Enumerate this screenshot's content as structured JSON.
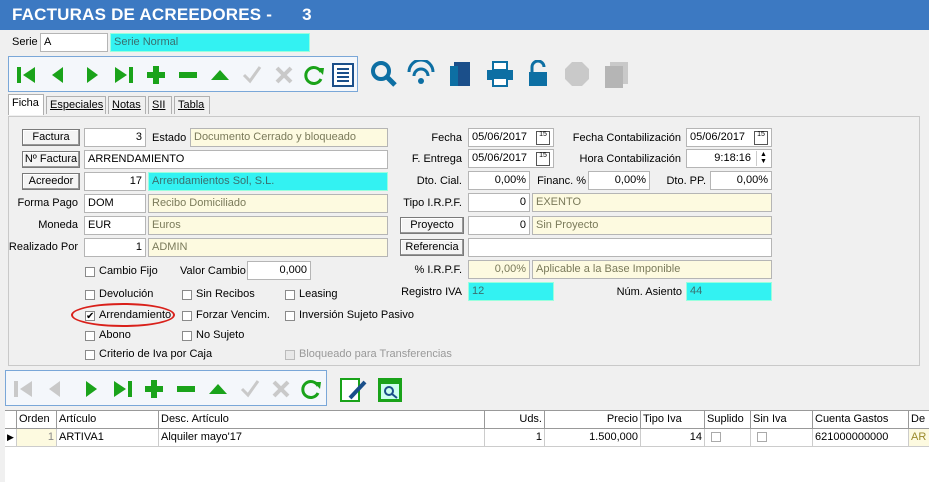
{
  "window": {
    "title": "FACTURAS DE ACREEDORES -",
    "number": "3"
  },
  "serie": {
    "label": "Serie",
    "code": "A",
    "name": "Serie Normal"
  },
  "toolbar_icons": [
    "first-icon",
    "prev-icon",
    "next-icon",
    "last-icon",
    "add-icon",
    "remove-icon",
    "up-icon",
    "check-icon",
    "cancel-icon",
    "refresh-icon",
    "list-icon",
    "search-icon",
    "wireless-icon",
    "door-icon",
    "print-icon",
    "unlock-icon",
    "circle-icon",
    "copy-icon"
  ],
  "tabs": [
    "Ficha",
    "Especiales",
    "Notas",
    "SII",
    "Tabla"
  ],
  "form": {
    "factura_label": "Factura",
    "factura": "3",
    "estado_label": "Estado",
    "estado": "Documento Cerrado y bloqueado",
    "nfactura_label": "Nº Factura",
    "nfactura": "ARRENDAMIENTO",
    "acreedor_label": "Acreedor",
    "acreedor_code": "17",
    "acreedor_name": "Arrendamientos Sol, S.L.",
    "formapago_label": "Forma Pago",
    "formapago_code": "DOM",
    "formapago_name": "Recibo Domiciliado",
    "moneda_label": "Moneda",
    "moneda_code": "EUR",
    "moneda_name": "Euros",
    "realizado_label": "Realizado Por",
    "realizado_code": "1",
    "realizado_name": "ADMIN",
    "fecha_label": "Fecha",
    "fecha": "05/06/2017",
    "fentrega_label": "F. Entrega",
    "fentrega": "05/06/2017",
    "fcontab_label": "Fecha Contabilización",
    "fcontab": "05/06/2017",
    "hcontab_label": "Hora Contabilización",
    "hcontab": "9:18:16",
    "dtocial_label": "Dto. Cial.",
    "dtocial": "0,00%",
    "financ_label": "Financ. %",
    "financ": "0,00%",
    "dtopp_label": "Dto. PP.",
    "dtopp": "0,00%",
    "irpf_label": "Tipo I.R.P.F.",
    "irpf_code": "0",
    "irpf_name": "EXENTO",
    "proyecto_label": "Proyecto",
    "proyecto_code": "0",
    "proyecto_name": "Sin Proyecto",
    "referencia_label": "Referencia",
    "referencia": "",
    "pirpf_label": "% I.R.P.F.",
    "pirpf": "0,00%",
    "pirpf_desc": "Aplicable a la Base Imponible",
    "regiva_label": "Registro IVA",
    "regiva": "12",
    "asiento_label": "Núm. Asiento",
    "asiento": "44",
    "valorcambio_label": "Valor Cambio",
    "valorcambio": "0,000"
  },
  "checks": {
    "cambio_fijo": "Cambio Fijo",
    "devolucion": "Devolución",
    "sin_recibos": "Sin Recibos",
    "leasing": "Leasing",
    "arrendamiento": "Arrendamiento",
    "forzar": "Forzar Vencim.",
    "inversion": "Inversión Sujeto Pasivo",
    "abono": "Abono",
    "no_sujeto": "No Sujeto",
    "criterio": "Criterio de Iva por Caja",
    "bloqueado": "Bloqueado para Transferencias"
  },
  "grid": {
    "headers": [
      "Orden",
      "Artículo",
      "Desc. Artículo",
      "Uds.",
      "Precio",
      "Tipo Iva",
      "Suplido",
      "Sin Iva",
      "Cuenta Gastos",
      "De"
    ],
    "row": {
      "orden": "1",
      "articulo": "ARTIVA1",
      "desc": "Alquiler mayo'17",
      "uds": "1",
      "precio": "1.500,000",
      "tipoiva": "14",
      "cuenta": "621000000000",
      "de": "AR"
    }
  },
  "colors": {
    "title_bg": "#3c79c2",
    "highlight": "#33f2f2",
    "green": "#1aa31a",
    "circle": "#d9201a"
  }
}
